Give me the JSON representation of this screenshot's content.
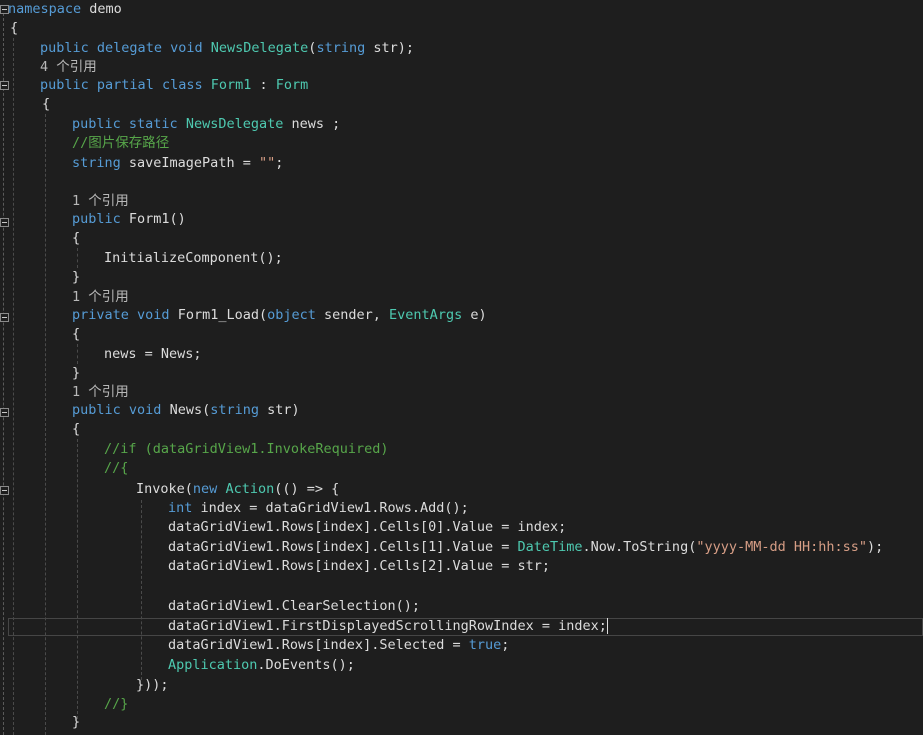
{
  "code": {
    "l01": {
      "a": "namespace",
      "b": " demo"
    },
    "l02": {
      "a": "{"
    },
    "l03": {
      "a": "public",
      "b": " ",
      "c": "delegate",
      "d": " ",
      "e": "void",
      "f": " ",
      "g": "NewsDelegate",
      "h": "(",
      "i": "string",
      "j": " str);"
    },
    "l04": {
      "a": "4 个引用"
    },
    "l05": {
      "a": "public",
      "b": " ",
      "c": "partial",
      "d": " ",
      "e": "class",
      "f": " ",
      "g": "Form1",
      "h": " : ",
      "i": "Form"
    },
    "l06": {
      "a": "{"
    },
    "l07": {
      "a": "public",
      "b": " ",
      "c": "static",
      "d": " ",
      "e": "NewsDelegate",
      "f": " news ;"
    },
    "l08": {
      "a": "//图片保存路径"
    },
    "l09": {
      "a": "string",
      "b": " saveImagePath = ",
      "c": "\"\"",
      "d": ";"
    },
    "l11": {
      "a": "1 个引用"
    },
    "l12": {
      "a": "public",
      "b": " Form1()"
    },
    "l13": {
      "a": "{"
    },
    "l14": {
      "a": "InitializeComponent();"
    },
    "l15": {
      "a": "}"
    },
    "l16": {
      "a": "1 个引用"
    },
    "l17": {
      "a": "private",
      "b": " ",
      "c": "void",
      "d": " Form1_Load(",
      "e": "object",
      "f": " sender, ",
      "g": "EventArgs",
      "h": " e)"
    },
    "l18": {
      "a": "{"
    },
    "l19": {
      "a": "news = News;"
    },
    "l20": {
      "a": "}"
    },
    "l21": {
      "a": "1 个引用"
    },
    "l22": {
      "a": "public",
      "b": " ",
      "c": "void",
      "d": " News(",
      "e": "string",
      "f": " str)"
    },
    "l23": {
      "a": "{"
    },
    "l24": {
      "a": "//if (dataGridView1.InvokeRequired)"
    },
    "l25": {
      "a": "//{"
    },
    "l26": {
      "a": "Invoke(",
      "b": "new",
      "c": " ",
      "d": "Action",
      "e": "(() => {"
    },
    "l27": {
      "a": "int",
      "b": " index = dataGridView1.Rows.Add();"
    },
    "l28": {
      "a": "dataGridView1.Rows[index].Cells[0].Value = index;"
    },
    "l29": {
      "a": "dataGridView1.Rows[index].Cells[1].Value = ",
      "b": "DateTime",
      "c": ".Now.ToString(",
      "d": "\"yyyy-MM-dd HH:hh:ss\"",
      "e": ");"
    },
    "l30": {
      "a": "dataGridView1.Rows[index].Cells[2].Value = str;"
    },
    "l32": {
      "a": "dataGridView1.ClearSelection();"
    },
    "l33": {
      "a": "dataGridView1.FirstDisplayedScrollingRowIndex = index;"
    },
    "l34": {
      "a": "dataGridView1.Rows[index].Selected = ",
      "b": "true",
      "c": ";"
    },
    "l35": {
      "a": "Application",
      "b": ".DoEvents();"
    },
    "l36": {
      "a": "}));"
    },
    "l37": {
      "a": "//}"
    },
    "l38": {
      "a": "}"
    }
  }
}
